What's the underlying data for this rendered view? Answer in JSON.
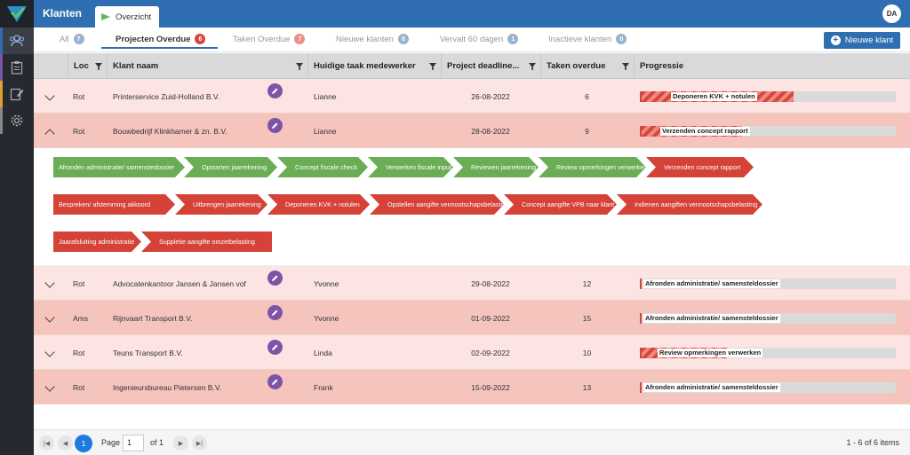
{
  "app": {
    "title": "Klanten",
    "active_tab": "Overzicht",
    "user_initials": "DA"
  },
  "filters": [
    {
      "label": "All",
      "count": "7",
      "badge_color": "#9ab3cc"
    },
    {
      "label": "Projecten Overdue",
      "count": "6",
      "badge_color": "#d9453b"
    },
    {
      "label": "Taken Overdue",
      "count": "7",
      "badge_color": "#e98f8a"
    },
    {
      "label": "Nieuwe klanten",
      "count": "0",
      "badge_color": "#9ab3cc"
    },
    {
      "label": "Vervalt 60 dagen",
      "count": "1",
      "badge_color": "#9ab3cc"
    },
    {
      "label": "Inactieve klanten",
      "count": "0",
      "badge_color": "#9ab3cc"
    }
  ],
  "new_button": "Nieuwe klant",
  "columns": [
    "Loc",
    "Klant naam",
    "Huidige taak medewerker",
    "Project deadline...",
    "Taken overdue",
    "Progressie"
  ],
  "rows": [
    {
      "loc": "Rot",
      "name": "Printerservice Zuid-Holland B.V.",
      "employee": "Lianne",
      "deadline": "26-08-2022",
      "overdue": "6",
      "progress_label": "Deponeren KVK + notulen",
      "progress": 0.6,
      "striped": true,
      "expanded": false
    },
    {
      "loc": "Rot",
      "name": "Bouwbedrijf Klinkhamer & zn. B.V.",
      "employee": "Lianne",
      "deadline": "28-08-2022",
      "overdue": "9",
      "progress_label": "Verzenden concept rapport",
      "progress": 0.4,
      "striped": true,
      "expanded": true
    },
    {
      "loc": "Rot",
      "name": "Advocatenkantoor Jansen & Jansen vof",
      "employee": "Yvonne",
      "deadline": "29-08-2022",
      "overdue": "12",
      "progress_label": "Afronden administratie/ samensteldossier",
      "progress": 0.0,
      "striped": false,
      "expanded": false
    },
    {
      "loc": "Ams",
      "name": "Rijnvaart Transport B.V.",
      "employee": "Yvonne",
      "deadline": "01-09-2022",
      "overdue": "15",
      "progress_label": "Afronden administratie/ samensteldossier",
      "progress": 0.0,
      "striped": false,
      "expanded": false
    },
    {
      "loc": "Rot",
      "name": "Teuns Transport B.V.",
      "employee": "Linda",
      "deadline": "02-09-2022",
      "overdue": "10",
      "progress_label": "Review opmerkingen verwerken",
      "progress": 0.34,
      "striped": true,
      "expanded": false
    },
    {
      "loc": "Rot",
      "name": "Ingenieursbureau Pietersen B.V.",
      "employee": "Frank",
      "deadline": "15-09-2022",
      "overdue": "13",
      "progress_label": "Afronden administratie/ samensteldossier",
      "progress": 0.0,
      "striped": false,
      "expanded": false
    }
  ],
  "steps": [
    [
      {
        "label": "Afronden administratie/ samenstedossier",
        "status": "done"
      },
      {
        "label": "Opstarten jaarrekening",
        "status": "done"
      },
      {
        "label": "Concept fiscale check",
        "status": "done"
      },
      {
        "label": "Verwerken fiscale input",
        "status": "done"
      },
      {
        "label": "Reviewen jaarrekening",
        "status": "done"
      },
      {
        "label": "Review opmerkingen verwerken",
        "status": "done"
      },
      {
        "label": "Verzenden concept rapport",
        "status": "open"
      }
    ],
    [
      {
        "label": "Bespreken/ afstemming akkoord",
        "status": "open"
      },
      {
        "label": "Uitbrengen jaarrekening",
        "status": "open"
      },
      {
        "label": "Deponeren KVK + notulen",
        "status": "open"
      },
      {
        "label": "Opstellen aangifte vennootschapsbelasting",
        "status": "open"
      },
      {
        "label": "Concept aangifte VPB naar klant",
        "status": "open"
      },
      {
        "label": "Indienen aangiften vennootschapsbelasting",
        "status": "open"
      }
    ],
    [
      {
        "label": "Jaarafsluiting administratie",
        "status": "open"
      },
      {
        "label": "Suppletie aangifte omzetbelasting",
        "status": "open"
      }
    ]
  ],
  "pager": {
    "page_label": "Page",
    "page_value": "1",
    "of_label": "of 1",
    "current": "1",
    "summary": "1 - 6 of 6 items"
  },
  "colors": {
    "topbar": "#2f6fb1",
    "rail": "#262a30",
    "row_light": "#fbe4e1",
    "row_dark": "#f4c4bd",
    "step_done": "#6aad55",
    "step_open": "#d44238",
    "edit": "#7e55a6"
  }
}
